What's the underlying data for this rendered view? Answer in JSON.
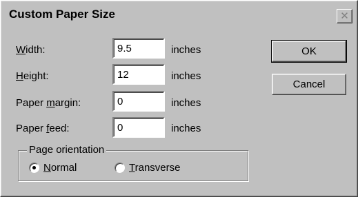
{
  "dialog": {
    "title": "Custom Paper Size",
    "close_icon": "close-icon"
  },
  "fields": {
    "width": {
      "label_pre": "",
      "label_key": "W",
      "label_post": "idth:",
      "value": "9.5",
      "unit": "inches"
    },
    "height": {
      "label_pre": "",
      "label_key": "H",
      "label_post": "eight:",
      "value": "12",
      "unit": "inches"
    },
    "margin": {
      "label_pre": "Paper ",
      "label_key": "m",
      "label_post": "argin:",
      "value": "0",
      "unit": "inches"
    },
    "feed": {
      "label_pre": "Paper ",
      "label_key": "f",
      "label_post": "eed:",
      "value": "0",
      "unit": "inches"
    }
  },
  "buttons": {
    "ok": "OK",
    "cancel": "Cancel"
  },
  "orientation": {
    "title": "Page orientation",
    "normal": {
      "key": "N",
      "rest": "ormal",
      "selected": true
    },
    "transverse": {
      "key": "T",
      "rest": "ransverse",
      "selected": false
    }
  }
}
